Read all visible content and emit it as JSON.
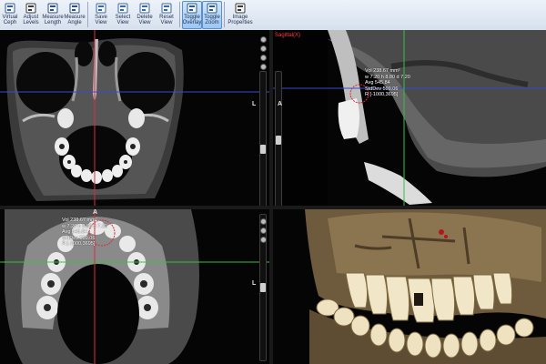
{
  "toolbar": {
    "buttons": [
      {
        "label": "Virtual\nCeph",
        "icon": "virtual-ceph-icon",
        "active": false
      },
      {
        "label": "Adjust\nLevels",
        "icon": "adjust-levels-icon",
        "active": false
      },
      {
        "label": "Measure\nLength",
        "icon": "measure-length-icon",
        "active": false
      },
      {
        "label": "Measure\nAngle",
        "icon": "measure-angle-icon",
        "active": false
      },
      {
        "label": "Save\nView",
        "icon": "save-view-icon",
        "active": false
      },
      {
        "label": "Select\nView",
        "icon": "select-view-icon",
        "active": false
      },
      {
        "label": "Delete\nView",
        "icon": "delete-view-icon",
        "active": false
      },
      {
        "label": "Reset\nView",
        "icon": "reset-view-icon",
        "active": false
      },
      {
        "label": "Toggle\nOverlay",
        "icon": "toggle-overlay-icon",
        "active": true
      },
      {
        "label": "Toggle\nZoom",
        "icon": "toggle-zoom-icon",
        "active": true
      },
      {
        "label": "Image\nProperties",
        "icon": "image-properties-icon",
        "active": false
      }
    ]
  },
  "viewports": {
    "coronal": {
      "orientation_label": "L"
    },
    "sagittal": {
      "title": "Sagittal(X)",
      "orientation_label": "A",
      "measurement": "Vol 238.67 mm³\nw 7.20 h 8.80 d 7.20\nAvg 545.84\nStdDev 599.06\nR [-1000,3695]"
    },
    "axial": {
      "top_label": "A",
      "orientation_label": "L",
      "measurement": "Vol 238.67 mm³\nw 7.20 h 8.80 d 7.20\nAvg 545.84\nStdDev 599.06\nR [-1000,3695]"
    },
    "render3d": {}
  },
  "colors": {
    "crosshair_red": "#d6303a",
    "crosshair_blue": "#3b4bd0",
    "crosshair_green": "#31c23d",
    "toolbar_bg": "#dfe7f2",
    "active_button": "#a9cdf3"
  }
}
